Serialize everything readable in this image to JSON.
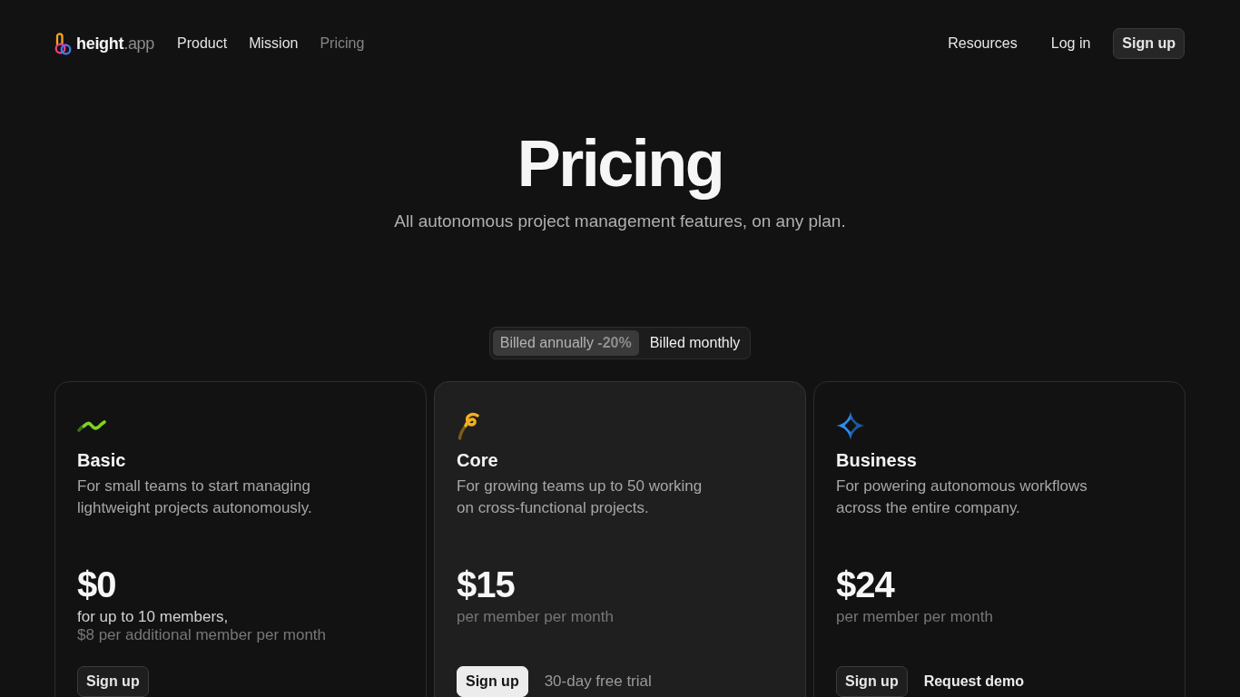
{
  "nav": {
    "logo": {
      "name": "height",
      "suffix": ".app"
    },
    "links": [
      {
        "label": "Product",
        "selected": false
      },
      {
        "label": "Mission",
        "selected": false
      },
      {
        "label": "Pricing",
        "selected": true
      }
    ],
    "actions": [
      {
        "label": "Resources",
        "kind": "link"
      },
      {
        "label": "Log in",
        "kind": "link"
      },
      {
        "label": "Sign up",
        "kind": "button"
      }
    ]
  },
  "hero": {
    "title": "Pricing",
    "subtitle": "All autonomous project management features, on any plan."
  },
  "billing_toggle": [
    {
      "label": "Billed annually",
      "badge": "-20%",
      "selected": true
    },
    {
      "label": "Billed monthly",
      "selected": false
    }
  ],
  "plans": [
    {
      "name": "Basic",
      "description": "For small teams to start managing lightweight projects autonomously.",
      "price": "$0",
      "highlighted": false,
      "price_notes": [
        {
          "text": "for up to 10 members,",
          "kind": "strong"
        },
        {
          "text": "$8 per additional member per month",
          "kind": "muted"
        }
      ],
      "actions": [
        {
          "label": "Sign up",
          "kind": "button"
        }
      ]
    },
    {
      "name": "Core",
      "description": "For growing teams up to 50 working on cross-functional projects.",
      "price": "$15",
      "highlighted": true,
      "price_notes": [
        {
          "text": "per member per month",
          "kind": "muted"
        }
      ],
      "actions": [
        {
          "label": "Sign up",
          "kind": "primary"
        },
        {
          "label": "30-day free trial",
          "kind": "note"
        }
      ]
    },
    {
      "name": "Business",
      "description": "For powering autonomous workflows across the entire company.",
      "price": "$24",
      "highlighted": false,
      "price_notes": [
        {
          "text": "per member per month",
          "kind": "muted"
        }
      ],
      "actions": [
        {
          "label": "Sign up",
          "kind": "button"
        },
        {
          "label": "Request demo",
          "kind": "link"
        }
      ]
    }
  ]
}
